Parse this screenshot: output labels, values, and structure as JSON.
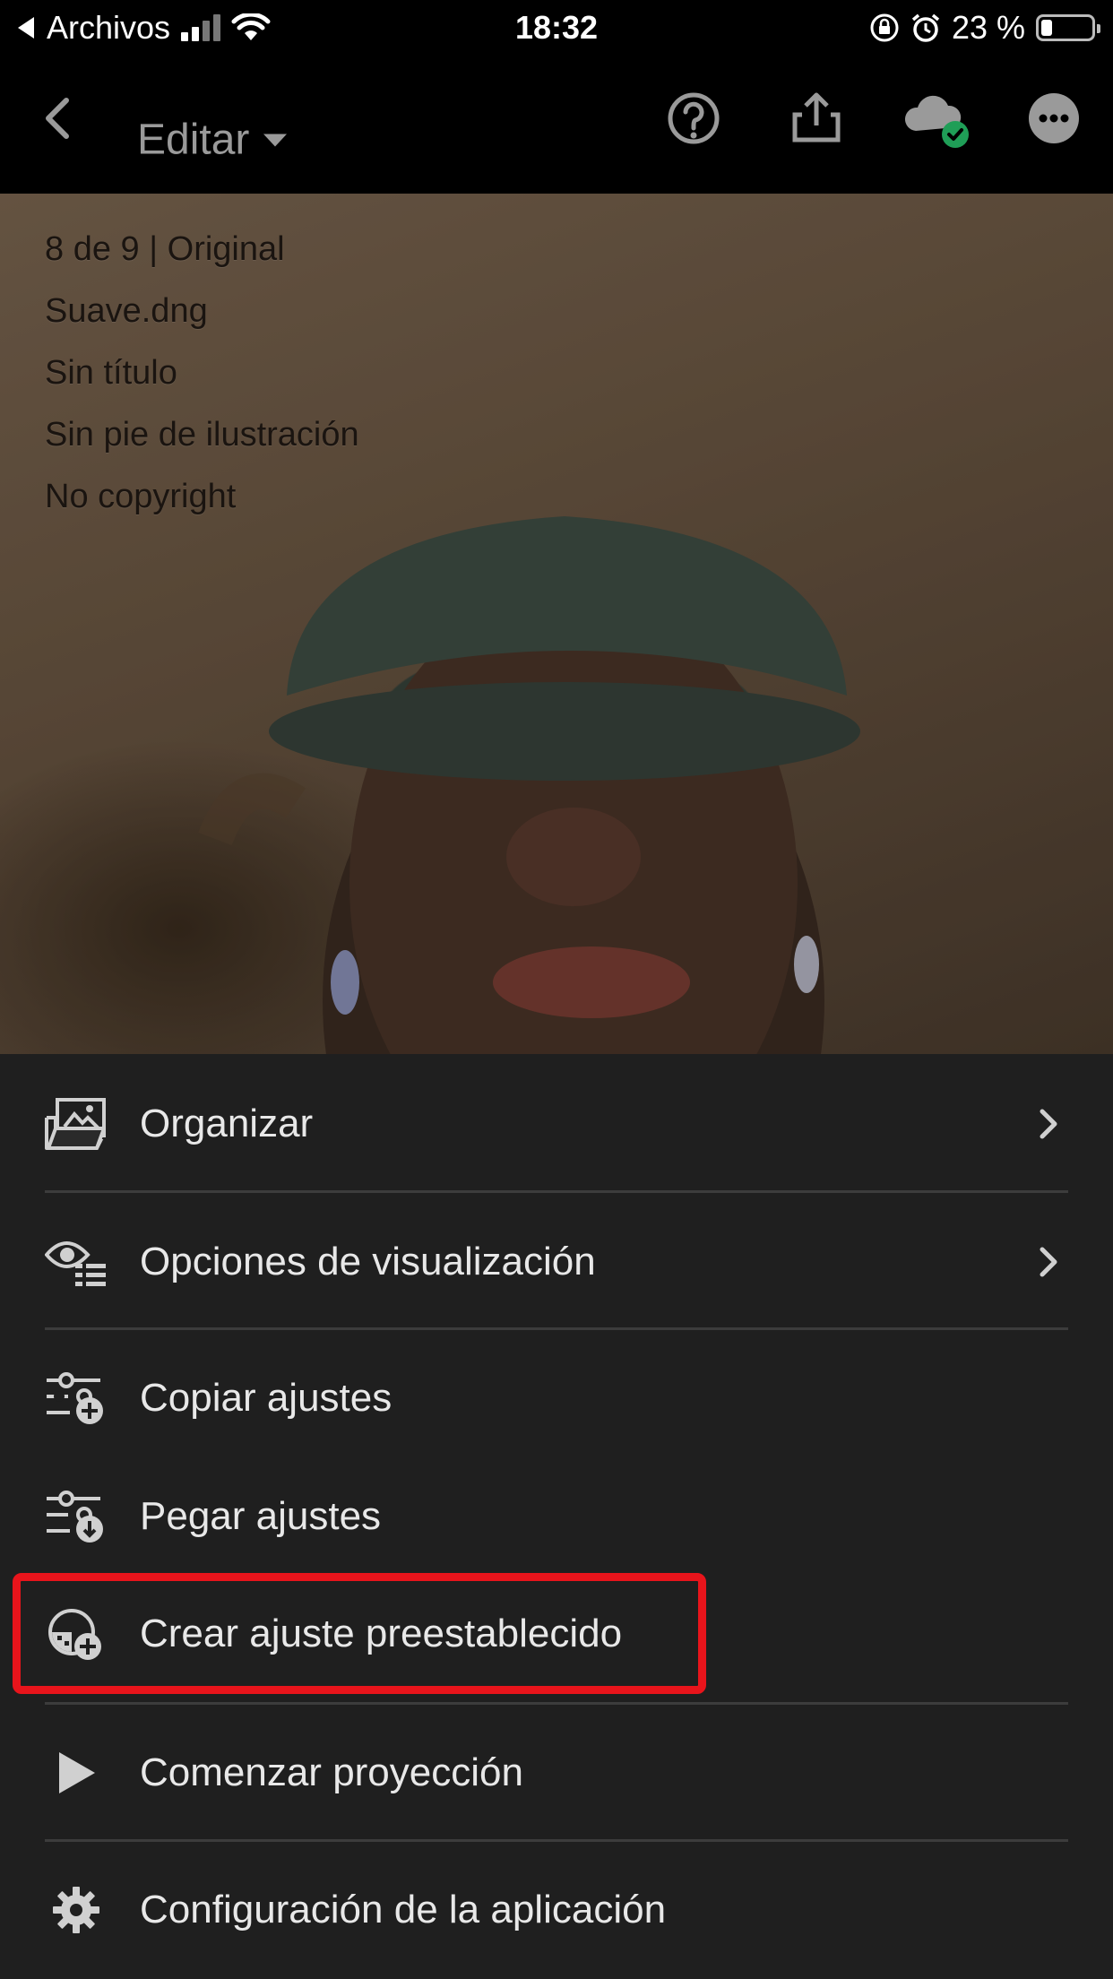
{
  "status_bar": {
    "back_app": "Archivos",
    "time": "18:32",
    "battery_text": "23 %",
    "battery_level": 0.23
  },
  "header": {
    "title": "Editar"
  },
  "photo_info": {
    "lines": [
      "8 de 9 | Original",
      "Suave.dng",
      "Sin título",
      "Sin pie de ilustración",
      "No copyright"
    ]
  },
  "menu": {
    "items": [
      {
        "label": "Organizar",
        "icon": "organize-icon",
        "has_chevron": true
      },
      {
        "label": "Opciones de visualización",
        "icon": "view-options-icon",
        "has_chevron": true
      },
      {
        "label": "Copiar ajustes",
        "icon": "copy-settings-icon",
        "has_chevron": false
      },
      {
        "label": "Pegar ajustes",
        "icon": "paste-settings-icon",
        "has_chevron": false
      },
      {
        "label": "Crear ajuste preestablecido",
        "icon": "create-preset-icon",
        "has_chevron": false
      },
      {
        "label": "Comenzar proyección",
        "icon": "play-icon",
        "has_chevron": false
      },
      {
        "label": "Configuración de la aplicación",
        "icon": "gear-icon",
        "has_chevron": false
      }
    ]
  },
  "colors": {
    "highlight": "#e8141b",
    "cloud_sync": "#1f9e57"
  }
}
